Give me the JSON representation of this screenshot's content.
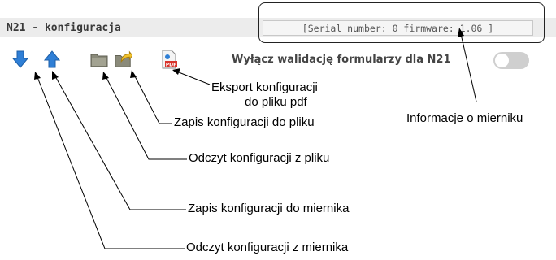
{
  "header": {
    "title": "N21 - konfiguracja",
    "device_info": "[Serial number: 0 firmware: 1.06 ]"
  },
  "toolbar": {
    "read_from_meter": {
      "icon": "arrow-down-icon"
    },
    "write_to_meter": {
      "icon": "arrow-up-icon"
    },
    "read_from_file": {
      "icon": "folder-icon"
    },
    "save_to_file": {
      "icon": "folder-save-icon"
    },
    "export_pdf": {
      "icon": "pdf-icon",
      "badge": "PDF"
    },
    "validation_label": "Wyłącz walidację formularzy dla N21",
    "validation_toggle_on": false
  },
  "annotations": {
    "export_pdf_line1": "Eksport konfiguracji",
    "export_pdf_line2": "do pliku pdf",
    "save_to_file": "Zapis konfiguracji do pliku",
    "read_from_file": "Odczyt konfiguracji z pliku",
    "write_to_meter": "Zapis konfiguracji do miernika",
    "read_from_meter": "Odczyt konfiguracji z miernika",
    "meter_info": "Informacje o mierniku"
  },
  "colors": {
    "arrow_blue": "#2f7fd6",
    "folder_gray": "#8a8a7a",
    "save_yellow": "#f2c22b",
    "pdf_red": "#d8342c",
    "header_bg": "#ececec",
    "toggle_off": "#cfcfcf"
  }
}
